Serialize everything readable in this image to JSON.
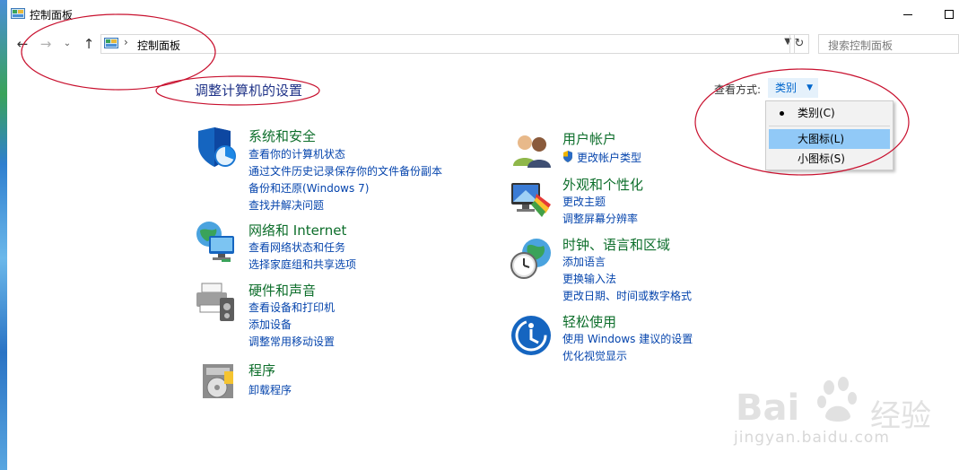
{
  "window": {
    "title": "控制面板"
  },
  "address_bar": {
    "location": "控制面板",
    "separator": "›",
    "search_placeholder": "搜索控制面板"
  },
  "page_title": "调整计算机的设置",
  "view_by": {
    "label": "查看方式:",
    "selected": "类别"
  },
  "view_menu": {
    "items": [
      {
        "label": "类别(C)"
      },
      {
        "label": "大图标(L)"
      },
      {
        "label": "小图标(S)"
      }
    ]
  },
  "categories": {
    "system_security": {
      "title": "系统和安全",
      "icon": "shield-icon",
      "links": [
        "查看你的计算机状态",
        "通过文件历史记录保存你的文件备份副本",
        "备份和还原(Windows 7)",
        "查找并解决问题"
      ]
    },
    "network": {
      "title": "网络和 Internet",
      "icon": "network-globe-icon",
      "links": [
        "查看网络状态和任务",
        "选择家庭组和共享选项"
      ]
    },
    "hardware": {
      "title": "硬件和声音",
      "icon": "printer-speaker-icon",
      "links": [
        "查看设备和打印机",
        "添加设备",
        "调整常用移动设置"
      ]
    },
    "programs": {
      "title": "程序",
      "icon": "programs-disc-icon",
      "links": [
        "卸载程序"
      ]
    },
    "user_accounts": {
      "title": "用户帐户",
      "icon": "users-icon",
      "links": [
        "更改帐户类型"
      ]
    },
    "appearance": {
      "title": "外观和个性化",
      "icon": "monitor-palette-icon",
      "links": [
        "更改主题",
        "调整屏幕分辨率"
      ]
    },
    "clock_region": {
      "title": "时钟、语言和区域",
      "icon": "clock-globe-icon",
      "links": [
        "添加语言",
        "更换输入法",
        "更改日期、时间或数字格式"
      ]
    },
    "ease_access": {
      "title": "轻松使用",
      "icon": "ease-of-access-icon",
      "links": [
        "使用 Windows 建议的设置",
        "优化视觉显示"
      ]
    }
  },
  "watermark": {
    "brand": "Bai",
    "brand_suffix": "经验",
    "url": "jingyan.baidu.com"
  },
  "colors": {
    "category_title": "#0d6e2b",
    "link": "#0645ad",
    "heading": "#1e3287",
    "annotation": "#c8102e",
    "menu_highlight": "#91c9f7"
  }
}
